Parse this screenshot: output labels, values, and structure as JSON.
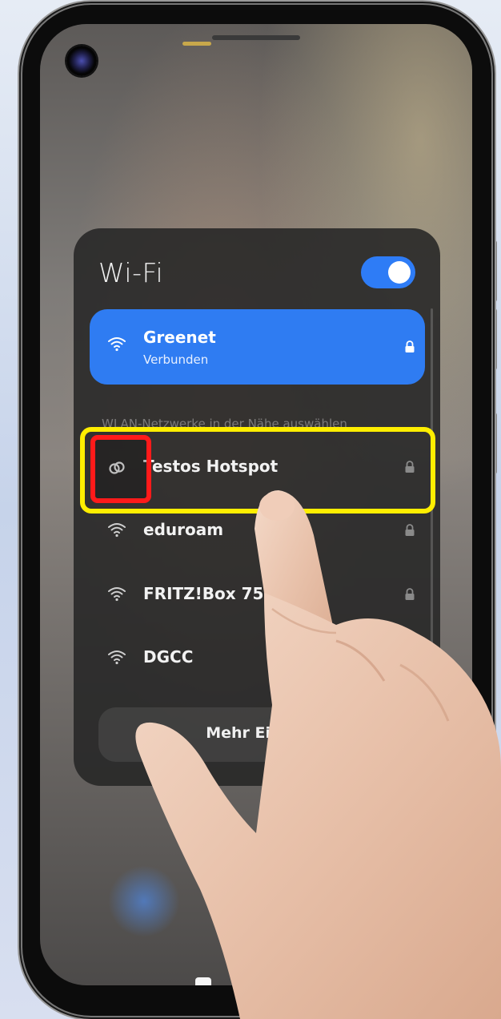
{
  "wifi_panel": {
    "title": "Wi-Fi",
    "toggle_state": "on",
    "connected_network": {
      "name": "Greenet",
      "status": "Verbunden",
      "icon": "wifi-icon",
      "secured": true
    },
    "section_label": "WLAN-Netzwerke in der Nähe auswählen",
    "networks": [
      {
        "name": "Testos Hotspot",
        "icon": "hotspot-link-icon",
        "secured": true
      },
      {
        "name": "eduroam",
        "icon": "wifi-icon",
        "secured": true
      },
      {
        "name": "FRITZ!Box 753",
        "icon": "wifi-icon",
        "secured": true
      },
      {
        "name": "DGCC",
        "icon": "wifi-icon",
        "secured": false
      }
    ],
    "more_settings_label": "Mehr Einste"
  },
  "colors": {
    "accent": "#2f7cf2",
    "highlight_row": "#ffee00",
    "highlight_icon": "#ff1a1a",
    "panel_bg": "#262626"
  }
}
